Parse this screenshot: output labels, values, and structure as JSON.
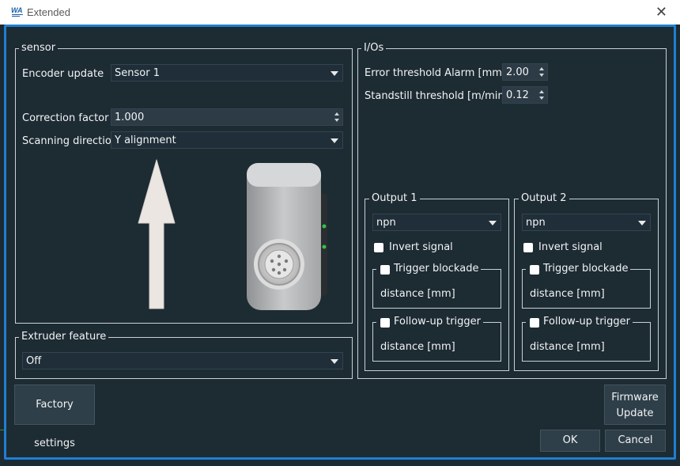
{
  "window": {
    "title": "Extended",
    "logo_text": "WA"
  },
  "sensor": {
    "legend": "sensor",
    "encoder_update_label": "Encoder update",
    "encoder_update_value": "Sensor 1",
    "correction_factor_label": "Correction factor",
    "correction_factor_value": "1.000",
    "scanning_direction_label": "Scanning direction",
    "scanning_direction_value": "Y alignment"
  },
  "extruder": {
    "legend": "Extruder feature",
    "value": "Off"
  },
  "ios": {
    "legend": "I/Os",
    "error_threshold_label": "Error threshold Alarm [mm]",
    "error_threshold_value": "2.00",
    "standstill_threshold_label": "Standstill threshold [m/min]",
    "standstill_threshold_value": "0.12"
  },
  "outputs": [
    {
      "legend": "Output 1",
      "type": "npn",
      "invert_label": "Invert signal",
      "trigger_blockade_label": "Trigger blockade",
      "trigger_distance_label": "distance [mm]",
      "follow_up_label": "Follow-up trigger",
      "follow_distance_label": "distance [mm]"
    },
    {
      "legend": "Output 2",
      "type": "npn",
      "invert_label": "Invert signal",
      "trigger_blockade_label": "Trigger blockade",
      "trigger_distance_label": "distance [mm]",
      "follow_up_label": "Follow-up trigger",
      "follow_distance_label": "distance [mm]"
    }
  ],
  "buttons": {
    "factory_settings": "Factory settings",
    "firmware_update_line1": "Firmware",
    "firmware_update_line2": "Update",
    "ok": "OK",
    "cancel": "Cancel"
  },
  "icons": {
    "close": "close-icon",
    "arrow": "arrow-up-icon",
    "sensor": "sensor-device-icon"
  },
  "colors": {
    "accent": "#1f7fd0",
    "background": "#1d2b33",
    "control": "#2f3f49"
  }
}
